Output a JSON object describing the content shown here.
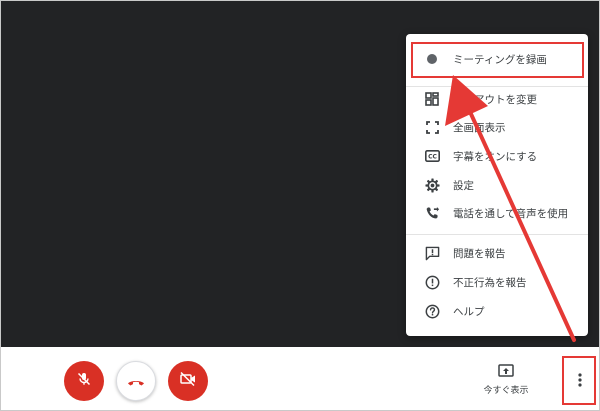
{
  "menu": {
    "items": [
      {
        "label": "ミーティングを録画",
        "icon": "record-dot-icon"
      },
      {
        "label": "レイアウトを変更",
        "icon": "layout-icon"
      },
      {
        "label": "全画面表示",
        "icon": "fullscreen-icon"
      },
      {
        "label": "字幕をオンにする",
        "icon": "captions-icon"
      },
      {
        "label": "設定",
        "icon": "gear-icon"
      },
      {
        "label": "電話を通して音声を使用",
        "icon": "phone-forward-icon"
      },
      {
        "label": "問題を報告",
        "icon": "feedback-icon"
      },
      {
        "label": "不正行為を報告",
        "icon": "alert-circle-icon"
      },
      {
        "label": "ヘルプ",
        "icon": "help-circle-icon"
      }
    ]
  },
  "controls": {
    "mic": {
      "icon": "mic-off-icon"
    },
    "hangup": {
      "icon": "phone-hangup-icon"
    },
    "camera": {
      "icon": "camera-off-icon"
    },
    "present": {
      "label": "今すぐ表示",
      "icon": "present-screen-icon"
    },
    "more": {
      "icon": "more-vertical-icon"
    }
  },
  "colors": {
    "video_bg": "#222325",
    "danger": "#d93025",
    "annotation": "#e53935",
    "text": "#3c4043"
  }
}
